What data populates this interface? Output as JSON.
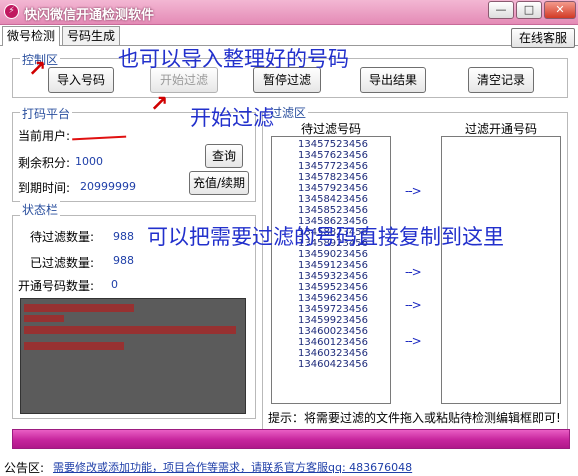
{
  "window": {
    "title": "快闪微信开通检测软件",
    "minimize_glyph": "—",
    "maximize_glyph": "□",
    "close_glyph": "✕"
  },
  "tabs": [
    {
      "label": "微号检测",
      "active": true
    },
    {
      "label": "号码生成",
      "active": false
    }
  ],
  "online_service_button": "在线客服",
  "control_area": {
    "label": "控制区",
    "buttons": {
      "import": "导入号码",
      "start": "开始过滤",
      "pause": "暂停过滤",
      "export": "导出结果",
      "clear": "清空记录"
    }
  },
  "platform": {
    "label": "打码平台",
    "current_user_label": "当前用户:",
    "points_label": "剩余积分:",
    "points_value": "1000",
    "expiry_label": "到期时间:",
    "expiry_value": "20999999",
    "query_button": "查询",
    "recharge_button": "充值/续期"
  },
  "status": {
    "label": "状态栏",
    "pending_label": "待过滤数量:",
    "pending_value": "988",
    "filtered_label": "已过滤数量:",
    "filtered_value": "988",
    "opened_label": "开通号码数量:",
    "opened_value": "0"
  },
  "filter_area": {
    "label": "过滤区",
    "pending_column": "待过滤号码",
    "opened_column": "过滤开通号码",
    "numbers": [
      "13457523456",
      "13457623456",
      "13457723456",
      "13457823456",
      "13457923456",
      "13458423456",
      "13458523456",
      "13458623456",
      "13458823456",
      "13458923456",
      "13459023456",
      "13459123456",
      "13459323456",
      "13459523456",
      "13459623456",
      "13459723456",
      "13459923456",
      "13460023456",
      "13460123456",
      "13460323456",
      "13460423456"
    ],
    "arrow": "-->",
    "hint": "提示：将需要过滤的文件拖入或粘贴待检测编辑框即可!"
  },
  "footer": {
    "label": "公告区:",
    "notice": "需要修改或添加功能，项目合作等需求，请联系官方客服qq: 483676048"
  },
  "annotations": {
    "import_hint": "也可以导入整理好的号码",
    "start_hint": "开始过滤",
    "paste_hint": "可以把需要过滤的号码直接复制到这里",
    "red_arrow": "↗"
  },
  "colors": {
    "title_bar": "#e48bb6",
    "progress_bar": "#c6259d",
    "group_label": "#2a4f9e",
    "annotation": "#2230cc",
    "log_background": "#5b5b5b"
  }
}
